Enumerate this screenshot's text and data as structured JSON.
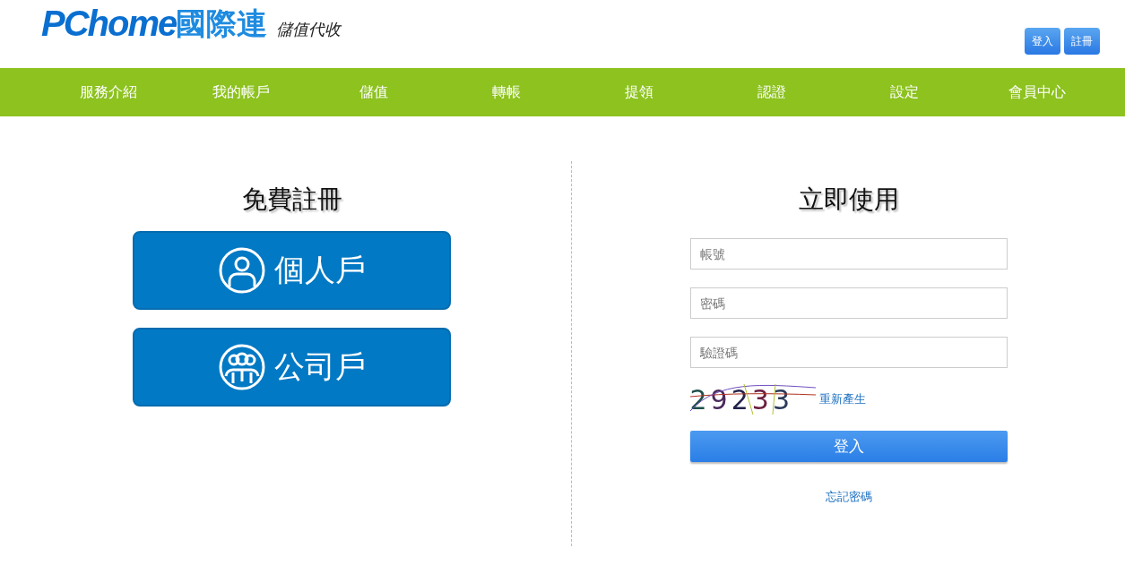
{
  "header": {
    "logo_latin": "PChome",
    "logo_cjk": "國際連",
    "tagline": "儲值代收",
    "buttons": [
      "登入",
      "註冊"
    ]
  },
  "nav": [
    {
      "label": "服務介紹"
    },
    {
      "label": "我的帳戶"
    },
    {
      "label": "儲值"
    },
    {
      "label": "轉帳"
    },
    {
      "label": "提領"
    },
    {
      "label": "認證"
    },
    {
      "label": "設定"
    },
    {
      "label": "會員中心"
    }
  ],
  "register": {
    "title": "免費註冊",
    "options": [
      {
        "label": "個人戶",
        "kind": "person"
      },
      {
        "label": "公司戶",
        "kind": "group"
      }
    ]
  },
  "login": {
    "title": "立即使用",
    "fields": [
      {
        "placeholder": "帳號"
      },
      {
        "placeholder": "密碼"
      },
      {
        "placeholder": "驗證碼"
      }
    ],
    "captcha": "29233",
    "refresh": "重新產生",
    "submit": "登入",
    "forgot": "忘記密碼"
  }
}
